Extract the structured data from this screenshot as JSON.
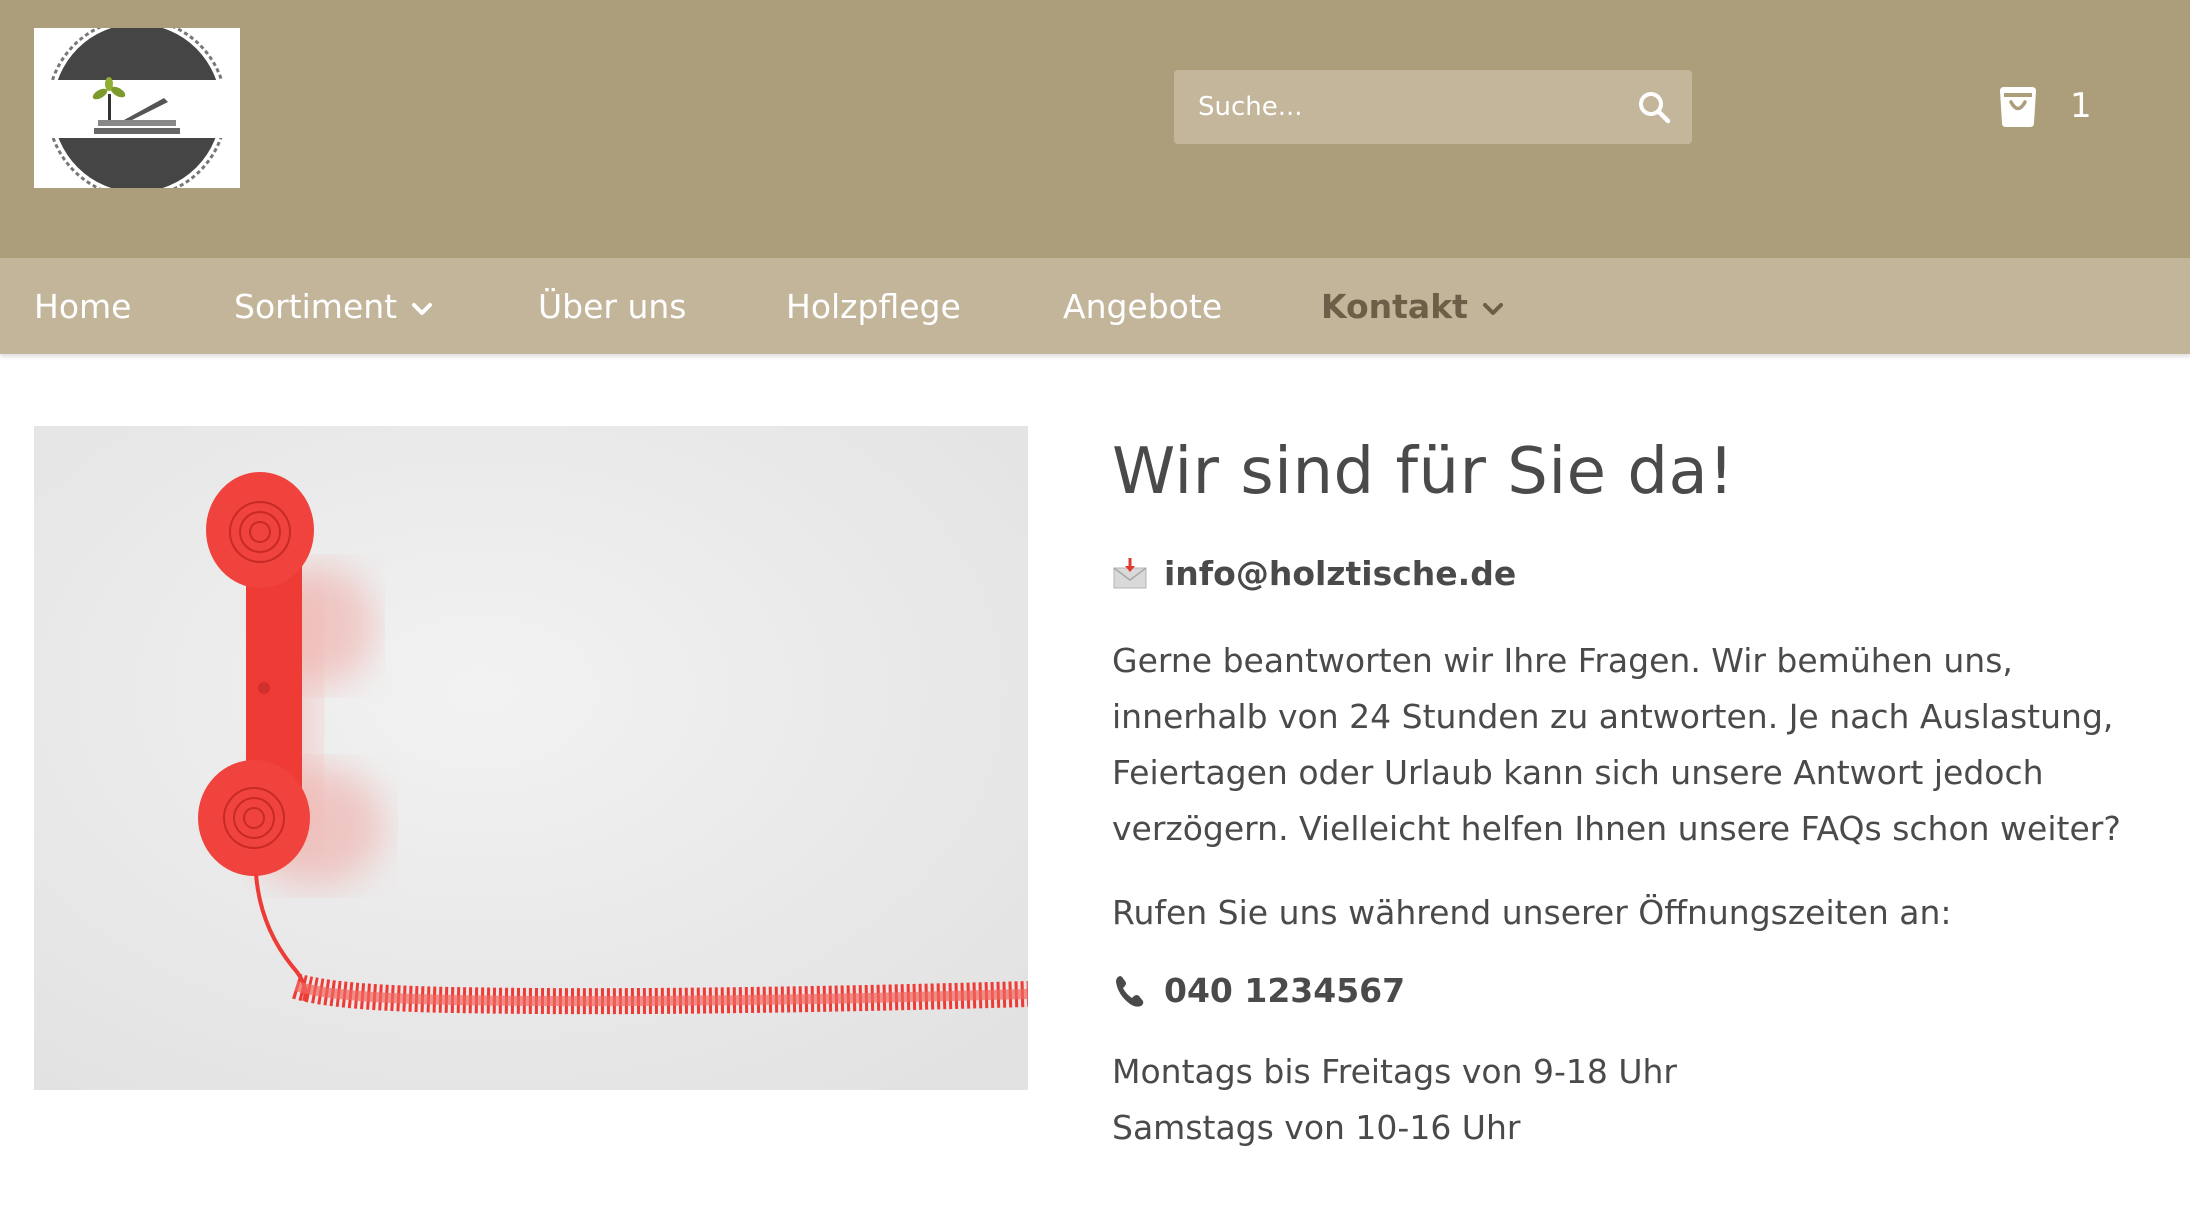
{
  "header": {
    "search": {
      "placeholder": "Suche..."
    },
    "cart": {
      "count": "1"
    },
    "colors": {
      "header_bg": "#ad9e7b",
      "nav_bg": "#c2b59a",
      "search_bg": "#c3b69b"
    }
  },
  "nav": {
    "items": [
      {
        "label": "Home"
      },
      {
        "label": "Sortiment"
      },
      {
        "label": "Über uns"
      },
      {
        "label": "Holzpflege"
      },
      {
        "label": "Angebote"
      },
      {
        "label": "Kontakt"
      }
    ],
    "active": "Kontakt"
  },
  "main": {
    "title": "Wir sind für Sie da!",
    "email": "info@holztische.de",
    "intro": "Gerne beantworten wir Ihre Fragen. Wir bemühen uns, innerhalb von 24 Stunden zu antworten. Je nach Auslastung, Feiertagen oder Urlaub kann sich unsere Antwort jedoch verzögern. Vielleicht helfen Ihnen unsere FAQs schon weiter?",
    "call_text": "Rufen Sie uns während unserer Öffnungszeiten an:",
    "phone": "040 1234567",
    "hours": [
      "Montags bis Freitags von 9-18 Uhr",
      "Samstags von 10-16 Uhr"
    ],
    "icons": {
      "email": "envelope-icon",
      "phone": "phone-icon"
    }
  }
}
